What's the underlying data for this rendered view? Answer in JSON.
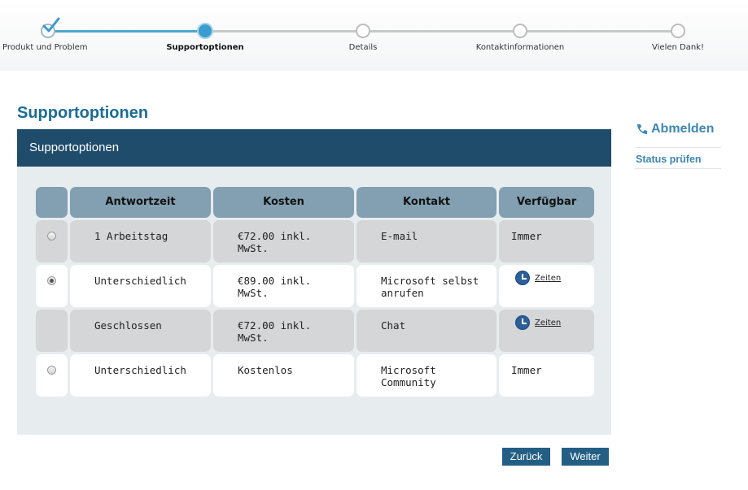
{
  "stepper": {
    "steps": [
      {
        "label": "Produkt und Problem",
        "state": "done"
      },
      {
        "label": "Supportoptionen",
        "state": "active"
      },
      {
        "label": "Details",
        "state": "pending"
      },
      {
        "label": "Kontaktinformationen",
        "state": "pending"
      },
      {
        "label": "Vielen Dank!",
        "state": "pending"
      }
    ]
  },
  "page": {
    "title": "Supportoptionen"
  },
  "panel": {
    "heading": "Supportoptionen"
  },
  "table": {
    "headers": [
      "",
      "Antwortzeit",
      "Kosten",
      "Kontakt",
      "Verfügbar"
    ],
    "rows": [
      {
        "radio": "unselected",
        "response": "1 Arbeitstag",
        "cost": "€72.00 inkl.\nMwSt.",
        "contact": "E-mail",
        "availability": "Immer",
        "availability_type": "text"
      },
      {
        "radio": "selected",
        "response": "Unterschiedlich",
        "cost": "€89.00 inkl.\nMwSt.",
        "contact": "Microsoft selbst\nanrufen",
        "availability": "Zeiten",
        "availability_type": "link"
      },
      {
        "radio": "none",
        "response": "Geschlossen",
        "cost": "€72.00 inkl.\nMwSt.",
        "contact": "Chat",
        "availability": "Zeiten",
        "availability_type": "link"
      },
      {
        "radio": "unselected",
        "response": "Unterschiedlich",
        "cost": "Kostenlos",
        "contact": "Microsoft\nCommunity",
        "availability": "Immer",
        "availability_type": "text"
      }
    ]
  },
  "buttons": {
    "back": "Zurück",
    "next": "Weiter"
  },
  "sidebar": {
    "signout": "Abmelden",
    "status": "Status prüfen"
  },
  "colors": {
    "accent": "#1c6c96",
    "header_bar": "#1f4c6b",
    "button": "#235f84",
    "progress": "#4ea6cf"
  },
  "icons": {
    "step_done": "checkmark-icon",
    "signout": "phone-hangup-icon",
    "hours": "clock-icon"
  }
}
